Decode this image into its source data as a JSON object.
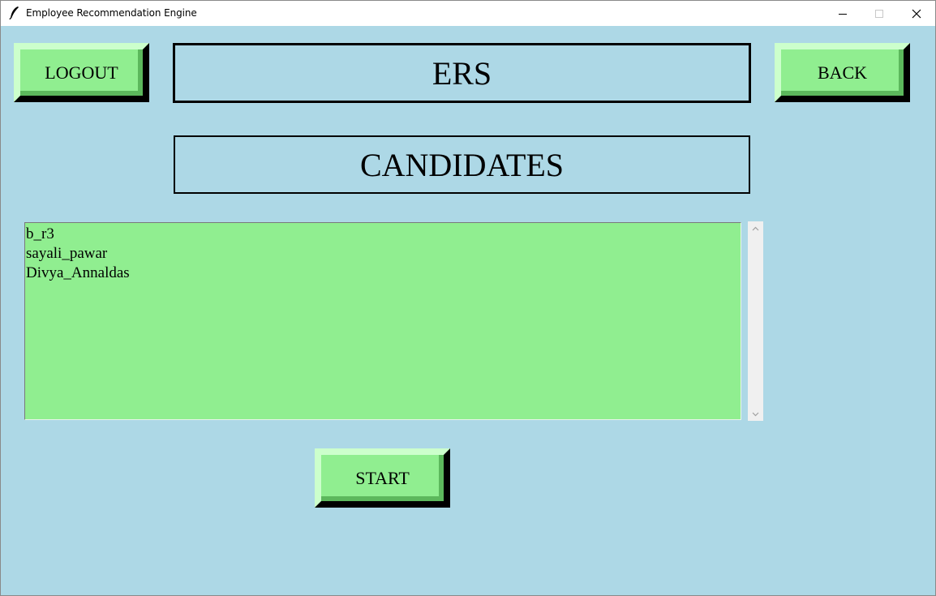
{
  "window": {
    "title": "Employee Recommendation Engine",
    "icon": "feather-icon"
  },
  "header": {
    "title": "ERS",
    "logout_label": "LOGOUT",
    "back_label": "BACK"
  },
  "section": {
    "heading": "CANDIDATES"
  },
  "candidates": {
    "items": [
      "b_r3",
      "sayali_pawar",
      "Divya_Annaldas"
    ]
  },
  "actions": {
    "start_label": "START"
  },
  "colors": {
    "background": "#add8e6",
    "button": "#90ee90",
    "listbox": "#90ee90"
  }
}
